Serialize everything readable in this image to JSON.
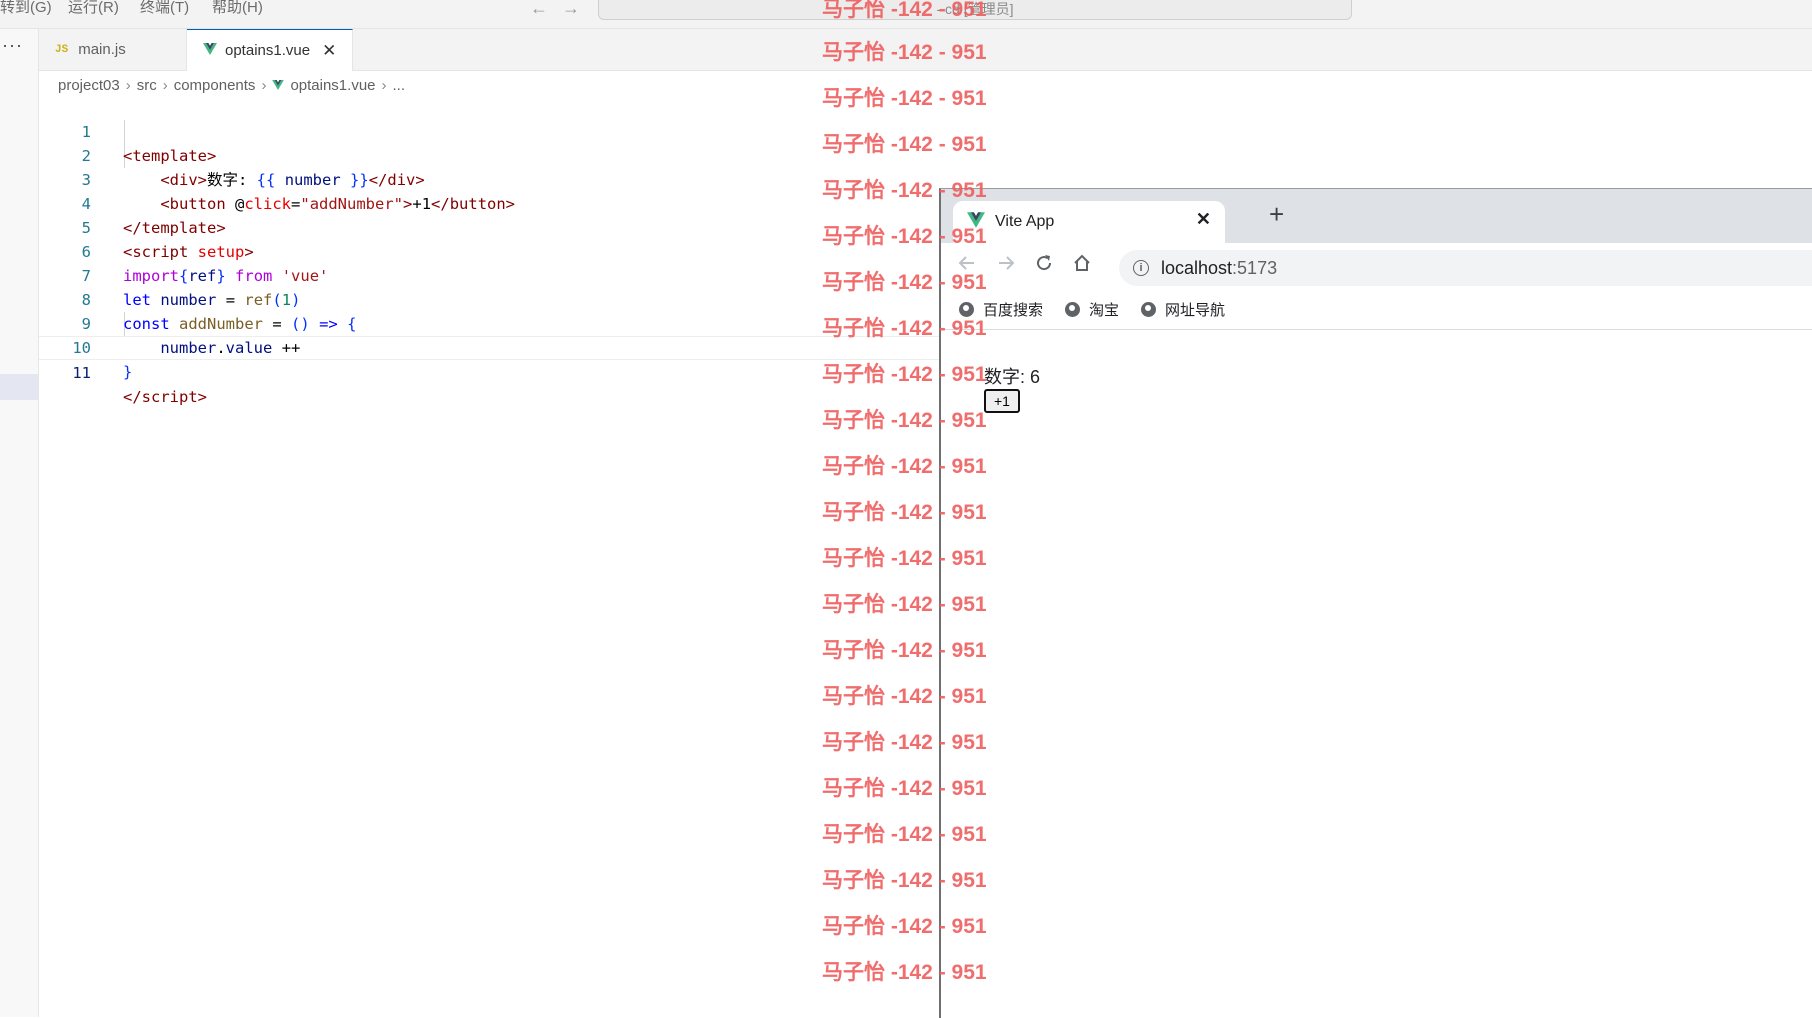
{
  "menubar": {
    "items": [
      "转到(G)",
      "运行(R)",
      "终端(T)",
      "帮助(H)"
    ],
    "back_arrow": "←",
    "forward_arrow": "→",
    "command_center_text": "- cd [管理员]"
  },
  "activity": {
    "more_icon": "···"
  },
  "tabs": [
    {
      "icon": "JS",
      "label": "main.js",
      "active": false
    },
    {
      "icon": "vue-icon",
      "label": "optains1.vue",
      "active": true,
      "close": "✕"
    }
  ],
  "breadcrumb": [
    "project03",
    "src",
    "components",
    "optains1.vue",
    "..."
  ],
  "editor": {
    "line_numbers": [
      "1",
      "2",
      "3",
      "4",
      "5",
      "6",
      "7",
      "8",
      "9",
      "10",
      "11"
    ],
    "current_line": "11"
  },
  "browser": {
    "tab_title": "Vite App",
    "tab_close": "✕",
    "new_tab": "+",
    "url_host": "localhost",
    "url_port": ":5173",
    "bookmarks": [
      "百度搜索",
      "淘宝",
      "网址导航"
    ],
    "page": {
      "number_text": "数字: 6",
      "button_label": "+1"
    }
  },
  "watermark": {
    "text": "马子怡 -142 - 951"
  },
  "colors": {
    "accent": "#005fb8",
    "watermark": "#ef5e5e",
    "line_number": "#237893"
  }
}
